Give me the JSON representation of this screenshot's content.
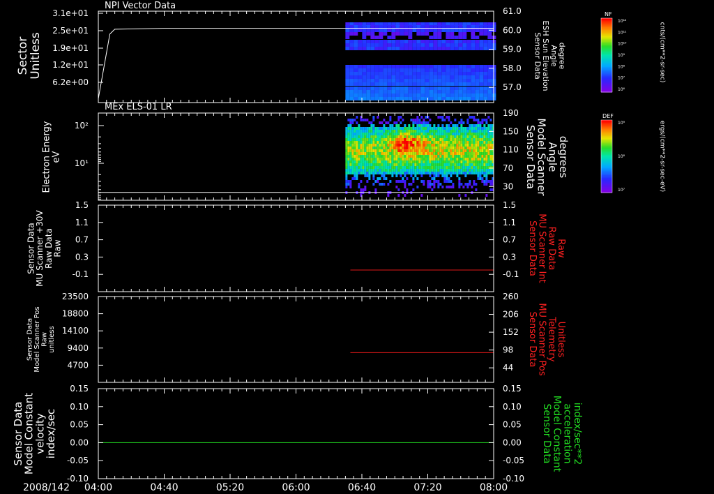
{
  "colors": {
    "frame": "#ffffff",
    "trace_white": "#ffffff",
    "trace_red": "#e01818",
    "trace_green": "#22dd22",
    "label_red": "#ff2020",
    "label_green": "#22dd22"
  },
  "time_axis": {
    "date_label": "2008/142",
    "tick_labels": [
      "04:00",
      "04:40",
      "05:20",
      "06:00",
      "06:40",
      "07:20",
      "08:00"
    ],
    "start": "04:00",
    "end": "08:00"
  },
  "chart_data": [
    {
      "type": "heatmap",
      "panel_title": "NPI Vector Data",
      "ylabel": [
        "Sector",
        "Unitless"
      ],
      "y_ticks": [
        "3.1e+01",
        "2.5e+01",
        "1.9e+01",
        "1.2e+01",
        "6.2e+00"
      ],
      "right_ylabel": [
        "Sensor Data",
        "ESH Sun Elevation",
        "Angle",
        "degree"
      ],
      "right_y_ticks": [
        "61.0",
        "60.0",
        "59.0",
        "58.0",
        "57.0"
      ],
      "right_ylim": [
        56.2,
        61.0
      ],
      "line_series": {
        "axis": "right",
        "color": "white",
        "x": [
          "04:00",
          "04:07",
          "04:10",
          "04:40",
          "08:00"
        ],
        "y": [
          56.4,
          59.8,
          60.05,
          60.1,
          60.1
        ]
      },
      "spectrogram": {
        "x_range": [
          "06:30",
          "08:00"
        ],
        "description_rows": "bands of purple/blue sectors with black gaps"
      },
      "colorbar": {
        "label": "NF",
        "units": "cnts/(cm**2-sr-sec)",
        "tick_labels": [
          "10¹²",
          "10¹¹",
          "10¹⁰",
          "10⁹",
          "10⁸",
          "10⁷",
          "10⁶"
        ]
      }
    },
    {
      "type": "heatmap",
      "panel_title": "MEx ELS-01 LR",
      "ylabel": [
        "Electron Energy",
        "eV"
      ],
      "y_scale": "log",
      "y_ticks": [
        "10²",
        "10¹"
      ],
      "right_ylabel": [
        "Sensor Data",
        "Model Scanner",
        "Angle",
        "degrees"
      ],
      "right_y_ticks": [
        "190",
        "150",
        "110",
        "70",
        "30"
      ],
      "right_ylim": [
        0,
        190
      ],
      "line_series": {
        "axis": "right",
        "color": "white",
        "x": [
          "04:00",
          "08:00"
        ],
        "y": [
          5,
          5
        ]
      },
      "spectrogram": {
        "x_range": [
          "06:30",
          "08:00"
        ],
        "peak_time": "07:05"
      },
      "colorbar": {
        "label": "DEF",
        "units": "ergs/(cm**2-sr-sec-eV)",
        "tick_labels": [
          "10⁹",
          "10⁸",
          "10⁷"
        ]
      }
    },
    {
      "type": "line",
      "ylabel": [
        "Sensor Data",
        "MU Scanner +30V",
        "Raw Data",
        "Raw"
      ],
      "y_ticks": [
        "1.5",
        "1.1",
        "0.7",
        "0.3",
        "-0.1"
      ],
      "ylim": [
        -0.5,
        1.5
      ],
      "right_ylabel": [
        "Sensor Data",
        "MU Scanner Int",
        "Raw Data",
        "Raw"
      ],
      "right_y_ticks": [
        "1.5",
        "1.1",
        "0.7",
        "0.3",
        "-0.1"
      ],
      "right_ylim": [
        -0.5,
        1.5
      ],
      "series": [
        {
          "axis": "right",
          "color": "red",
          "x": [
            "06:33",
            "08:00"
          ],
          "y": [
            0.0,
            0.0
          ]
        }
      ]
    },
    {
      "type": "line",
      "ylabel": [
        "Sensor Data",
        "Model Scanner Pos",
        "Raw",
        "unitless"
      ],
      "y_ticks": [
        "23500",
        "18800",
        "14100",
        "9400",
        "4700"
      ],
      "ylim": [
        0,
        23500
      ],
      "right_ylabel": [
        "Sensor Data",
        "MU Scanner Pos",
        "Telemetry",
        "Unitless"
      ],
      "right_y_ticks": [
        "260",
        "206",
        "152",
        "98",
        "44"
      ],
      "right_ylim": [
        0,
        260
      ],
      "series": [
        {
          "axis": "right",
          "color": "red",
          "x": [
            "06:33",
            "08:00"
          ],
          "y": [
            90,
            90
          ]
        }
      ]
    },
    {
      "type": "line",
      "ylabel": [
        "Sensor Data",
        "Model Constant",
        "velocity",
        "index/sec"
      ],
      "y_ticks": [
        "0.15",
        "0.10",
        "0.05",
        "0.00",
        "-0.05",
        "-0.10"
      ],
      "ylim": [
        -0.1,
        0.15
      ],
      "right_ylabel": [
        "Sensor Data",
        "Model Constant",
        "acceleration",
        "index/sec**2"
      ],
      "right_y_ticks": [
        "0.15",
        "0.10",
        "0.05",
        "0.00",
        "-0.05",
        "-0.10"
      ],
      "right_ylim": [
        -0.1,
        0.15
      ],
      "series": [
        {
          "axis": "left",
          "color": "green",
          "x": [
            "04:00",
            "08:00"
          ],
          "y": [
            0.0,
            0.0
          ]
        }
      ]
    }
  ]
}
